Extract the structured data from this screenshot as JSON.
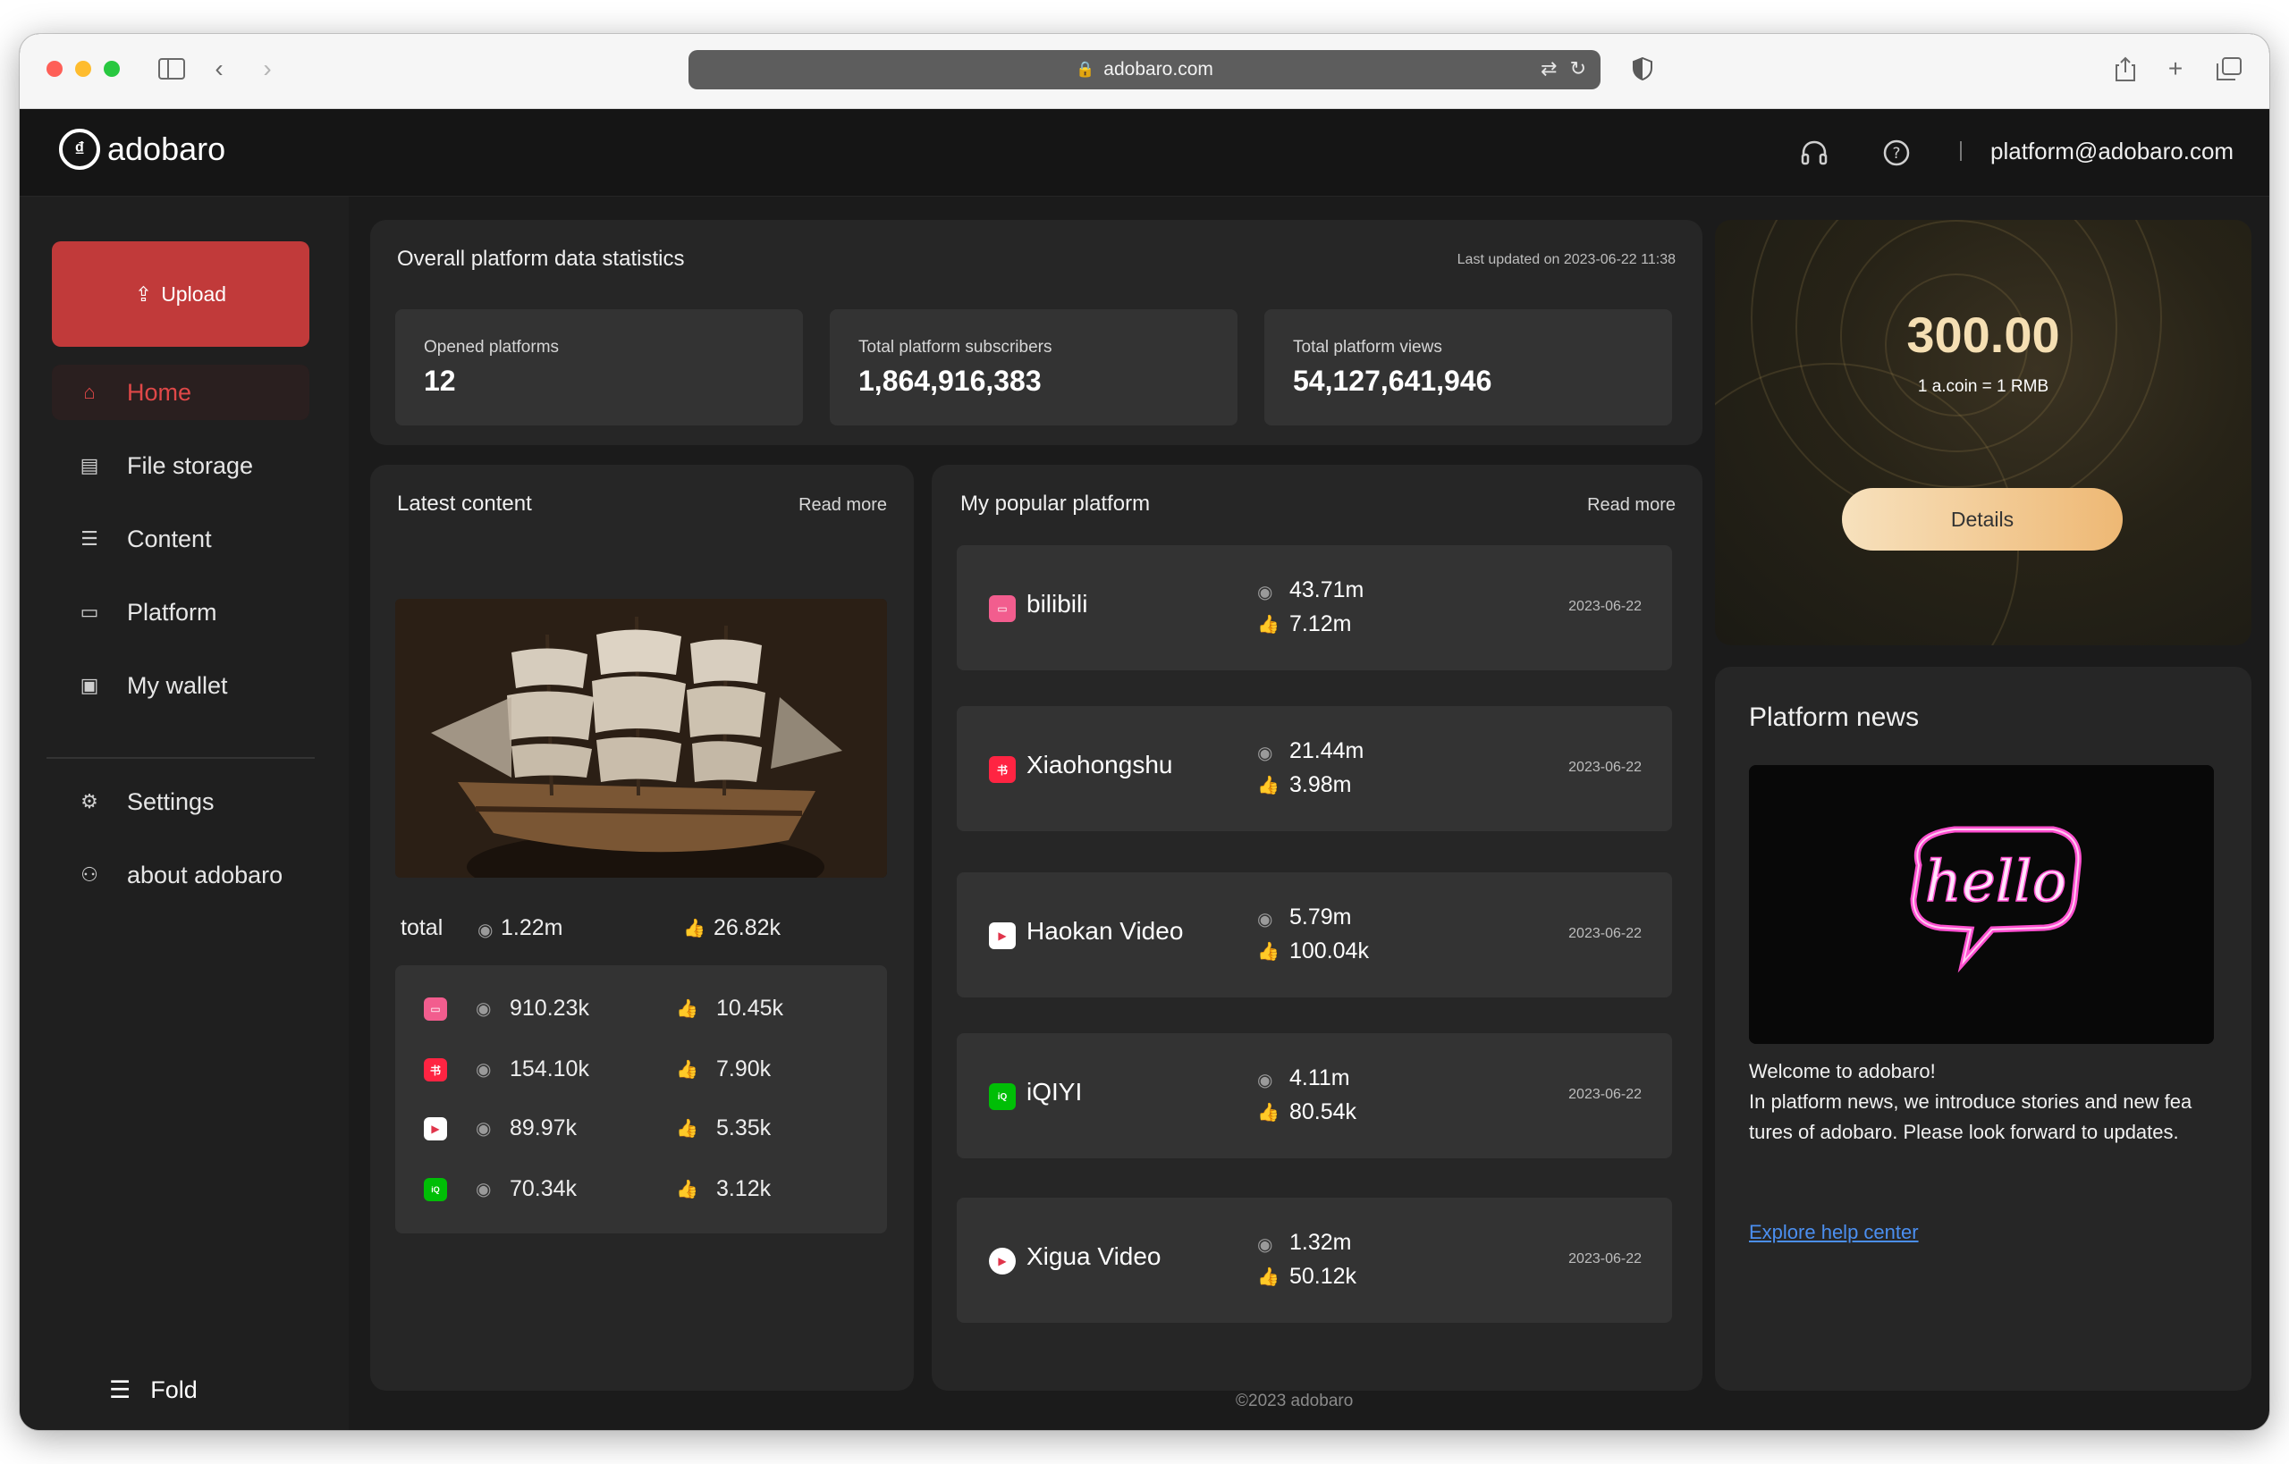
{
  "browser": {
    "url": "adobaro.com"
  },
  "app": {
    "logo_text": "adobaro",
    "email": "platform@adobaro.com"
  },
  "sidebar": {
    "upload_label": "Upload",
    "items": [
      {
        "label": "Home",
        "icon": "home-icon",
        "active": true
      },
      {
        "label": "File storage",
        "icon": "file-storage-icon"
      },
      {
        "label": "Content",
        "icon": "content-icon"
      },
      {
        "label": "Platform",
        "icon": "platform-icon"
      },
      {
        "label": "My wallet",
        "icon": "wallet-icon"
      },
      {
        "label": "Settings",
        "icon": "settings-icon"
      },
      {
        "label": "about adobaro",
        "icon": "user-icon"
      }
    ],
    "fold_label": "Fold"
  },
  "stats": {
    "title": "Overall platform data statistics",
    "updated": "Last updated on 2023-06-22 11:38",
    "opened_label": "Opened platforms",
    "opened_value": "12",
    "subs_label": "Total platform subscribers",
    "subs_value": "1,864,916,383",
    "views_label": "Total platform views",
    "views_value": "54,127,641,946"
  },
  "latest": {
    "title": "Latest content",
    "more": "Read more",
    "total_label": "total",
    "total_views": "1.22m",
    "total_likes": "26.82k",
    "rows": [
      {
        "platform": "bilibili",
        "color": "#f25d8e",
        "views": "910.23k",
        "likes": "10.45k"
      },
      {
        "platform": "xiaohongshu",
        "color": "#ff2442",
        "views": "154.10k",
        "likes": "7.90k"
      },
      {
        "platform": "haokan",
        "color": "#ffffff",
        "views": "89.97k",
        "likes": "5.35k"
      },
      {
        "platform": "iqiyi",
        "color": "#00be06",
        "views": "70.34k",
        "likes": "3.12k"
      }
    ]
  },
  "popular": {
    "title": "My popular platform",
    "more": "Read more",
    "rows": [
      {
        "name": "bilibili",
        "color": "#f25d8e",
        "views": "43.71m",
        "likes": "7.12m",
        "date": "2023-06-22"
      },
      {
        "name": "Xiaohongshu",
        "color": "#ff2442",
        "views": "21.44m",
        "likes": "3.98m",
        "date": "2023-06-22"
      },
      {
        "name": "Haokan Video",
        "color": "#ffffff",
        "views": "5.79m",
        "likes": "100.04k",
        "date": "2023-06-22"
      },
      {
        "name": "iQIYI",
        "color": "#00be06",
        "views": "4.11m",
        "likes": "80.54k",
        "date": "2023-06-22"
      },
      {
        "name": "Xigua Video",
        "color": "#ffffff",
        "views": "1.32m",
        "likes": "50.12k",
        "date": "2023-06-22"
      }
    ]
  },
  "wallet": {
    "value": "300.00",
    "rate": "1 a.coin = 1 RMB",
    "details_label": "Details"
  },
  "news": {
    "title": "Platform news",
    "line1": "Welcome  to adobaro!",
    "line2": "In platform news, we introduce stories and new fea",
    "line3": "tures of adobaro. Please look forward to updates.",
    "link": "Explore help center",
    "neon_text": "hello"
  },
  "footer": "©2023 adobaro"
}
